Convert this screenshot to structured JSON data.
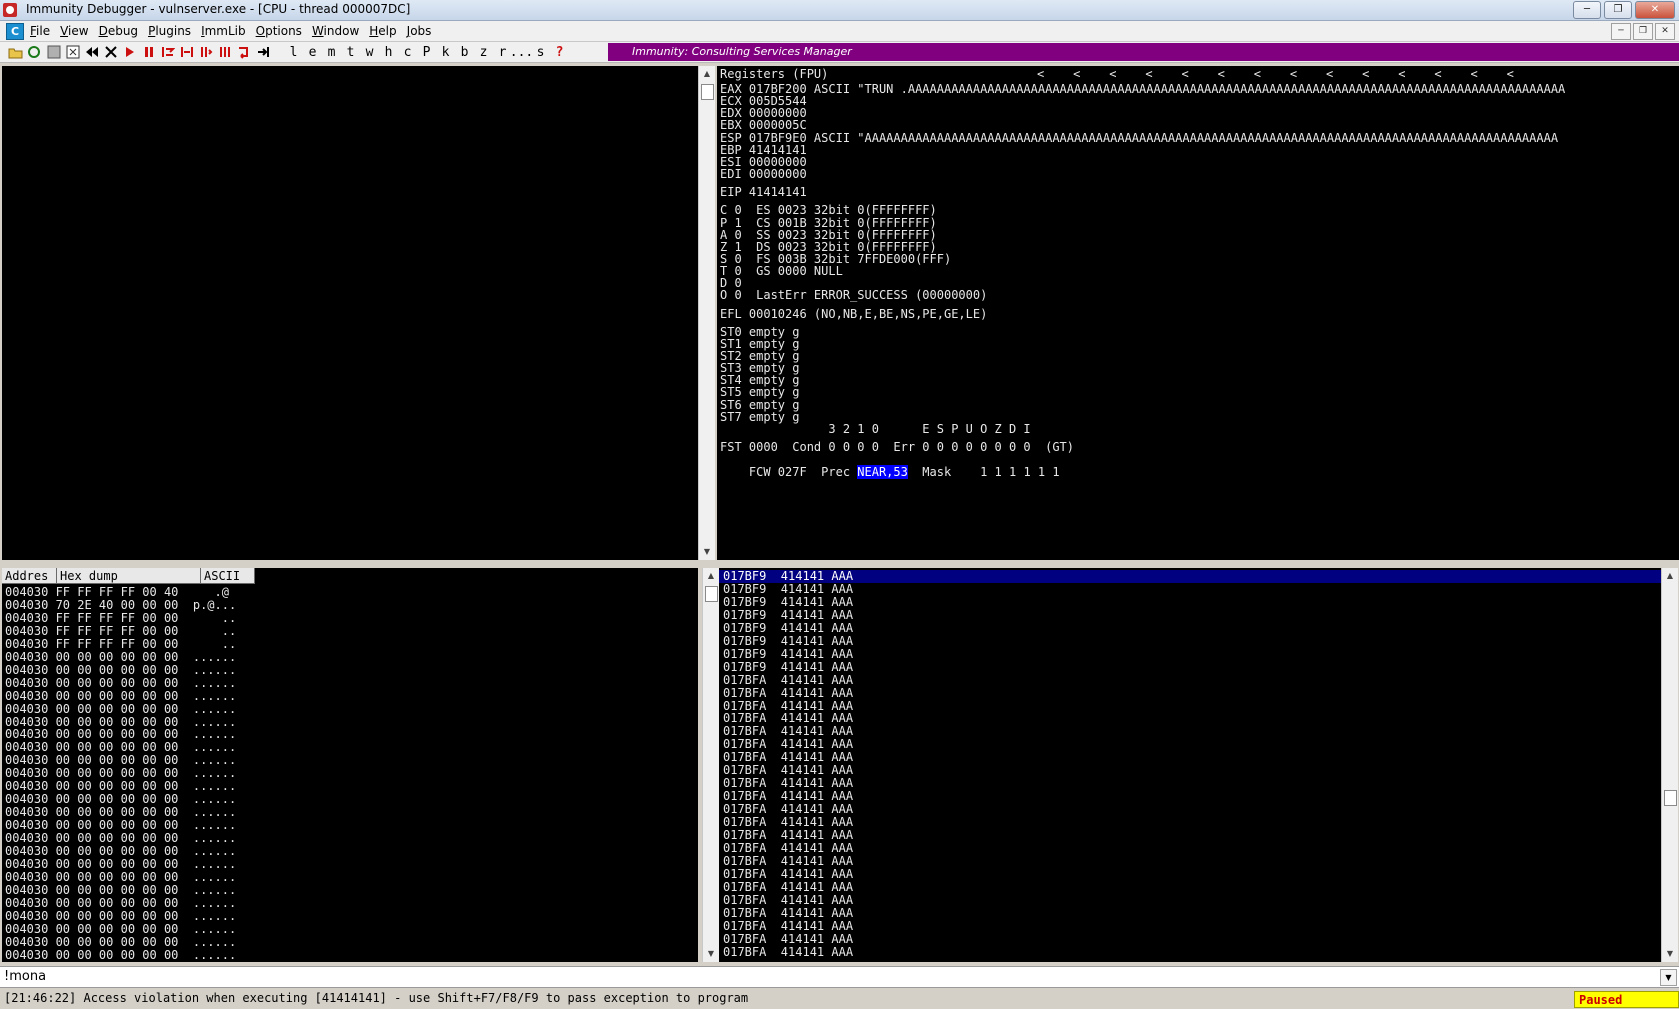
{
  "window": {
    "title": "Immunity Debugger - vulnserver.exe - [CPU - thread 000007DC]",
    "controls": [
      "─",
      "❐",
      "✕"
    ],
    "mdi_controls": [
      "─",
      "❐",
      "✕"
    ]
  },
  "menu": {
    "app_letter": "C",
    "items": [
      {
        "u": "F",
        "rest": "ile"
      },
      {
        "u": "V",
        "rest": "iew"
      },
      {
        "u": "D",
        "rest": "ebug"
      },
      {
        "u": "P",
        "rest": "lugins"
      },
      {
        "u": "I",
        "rest": "mmLib"
      },
      {
        "u": "O",
        "rest": "ptions"
      },
      {
        "u": "W",
        "rest": "indow"
      },
      {
        "u": "H",
        "rest": "elp"
      },
      {
        "u": "J",
        "rest": "obs"
      }
    ]
  },
  "toolbar": {
    "letters": [
      "l",
      "e",
      "m",
      "t",
      "w",
      "h",
      "c",
      "P",
      "k",
      "b",
      "z",
      "r",
      "...",
      "s",
      "?"
    ],
    "banner": "Immunity: Consulting Services Manager"
  },
  "registers": {
    "header": "Registers (FPU)",
    "arrows": "<    <    <    <    <    <    <    <    <    <    <    <    <    <",
    "lines": [
      "EAX 017BF200 ASCII \"TRUN .AAAAAAAAAAAAAAAAAAAAAAAAAAAAAAAAAAAAAAAAAAAAAAAAAAAAAAAAAAAAAAAAAAAAAAAAAAAAAAAAAAAAAAAAAAA",
      "ECX 005D5544",
      "EDX 00000000",
      "EBX 0000005C",
      "ESP 017BF9E0 ASCII \"AAAAAAAAAAAAAAAAAAAAAAAAAAAAAAAAAAAAAAAAAAAAAAAAAAAAAAAAAAAAAAAAAAAAAAAAAAAAAAAAAAAAAAAAAAAAAAAA",
      "EBP 41414141",
      "ESI 00000000",
      "EDI 00000000",
      "EIP 41414141",
      "C 0  ES 0023 32bit 0(FFFFFFFF)",
      "P 1  CS 001B 32bit 0(FFFFFFFF)",
      "A 0  SS 0023 32bit 0(FFFFFFFF)",
      "Z 1  DS 0023 32bit 0(FFFFFFFF)",
      "S 0  FS 003B 32bit 7FFDE000(FFF)",
      "T 0  GS 0000 NULL",
      "D 0",
      "O 0  LastErr ERROR_SUCCESS (00000000)",
      "EFL 00010246 (NO,NB,E,BE,NS,PE,GE,LE)",
      "ST0 empty g",
      "ST1 empty g",
      "ST2 empty g",
      "ST3 empty g",
      "ST4 empty g",
      "ST5 empty g",
      "ST6 empty g",
      "ST7 empty g",
      "               3 2 1 0      E S P U O Z D I",
      "FST 0000  Cond 0 0 0 0  Err 0 0 0 0 0 0 0 0  (GT)"
    ],
    "fcw_prefix": "FCW 027F  Prec ",
    "fcw_highlight": "NEAR,53",
    "fcw_suffix": "  Mask    1 1 1 1 1 1"
  },
  "hexdump": {
    "headers": [
      "Addres",
      "Hex dump",
      "ASCII"
    ],
    "rows": [
      "004030 FF FF FF FF 00 40     .@",
      "004030 70 2E 40 00 00 00  p.@...",
      "004030 FF FF FF FF 00 00      ..",
      "004030 FF FF FF FF 00 00      ..",
      "004030 FF FF FF FF 00 00      ..",
      "004030 00 00 00 00 00 00  ......",
      "004030 00 00 00 00 00 00  ......",
      "004030 00 00 00 00 00 00  ......",
      "004030 00 00 00 00 00 00  ......",
      "004030 00 00 00 00 00 00  ......",
      "004030 00 00 00 00 00 00  ......",
      "004030 00 00 00 00 00 00  ......",
      "004030 00 00 00 00 00 00  ......",
      "004030 00 00 00 00 00 00  ......",
      "004030 00 00 00 00 00 00  ......",
      "004030 00 00 00 00 00 00  ......",
      "004030 00 00 00 00 00 00  ......",
      "004030 00 00 00 00 00 00  ......",
      "004030 00 00 00 00 00 00  ......",
      "004030 00 00 00 00 00 00  ......",
      "004030 00 00 00 00 00 00  ......",
      "004030 00 00 00 00 00 00  ......",
      "004030 00 00 00 00 00 00  ......",
      "004030 00 00 00 00 00 00  ......",
      "004030 00 00 00 00 00 00  ......",
      "004030 00 00 00 00 00 00  ......",
      "004030 00 00 00 00 00 00  ......",
      "004030 00 00 00 00 00 00  ......",
      "004030 00 00 00 00 00 00  ......",
      "004030 00 00 00 00 00 00  ......"
    ]
  },
  "stack": {
    "rows": [
      "017BF9  414141 AAA",
      "017BF9  414141 AAA",
      "017BF9  414141 AAA",
      "017BF9  414141 AAA",
      "017BF9  414141 AAA",
      "017BF9  414141 AAA",
      "017BF9  414141 AAA",
      "017BF9  414141 AAA",
      "017BFA  414141 AAA",
      "017BFA  414141 AAA",
      "017BFA  414141 AAA",
      "017BFA  414141 AAA",
      "017BFA  414141 AAA",
      "017BFA  414141 AAA",
      "017BFA  414141 AAA",
      "017BFA  414141 AAA",
      "017BFA  414141 AAA",
      "017BFA  414141 AAA",
      "017BFA  414141 AAA",
      "017BFA  414141 AAA",
      "017BFA  414141 AAA",
      "017BFA  414141 AAA",
      "017BFA  414141 AAA",
      "017BFA  414141 AAA",
      "017BFA  414141 AAA",
      "017BFA  414141 AAA",
      "017BFA  414141 AAA",
      "017BFA  414141 AAA",
      "017BFA  414141 AAA",
      "017BFA  414141 AAA"
    ]
  },
  "command": {
    "value": "!mona"
  },
  "status": {
    "message": "[21:46:22] Access violation when executing [41414141] - use Shift+F7/F8/F9 to pass exception to program",
    "state": "Paused"
  }
}
